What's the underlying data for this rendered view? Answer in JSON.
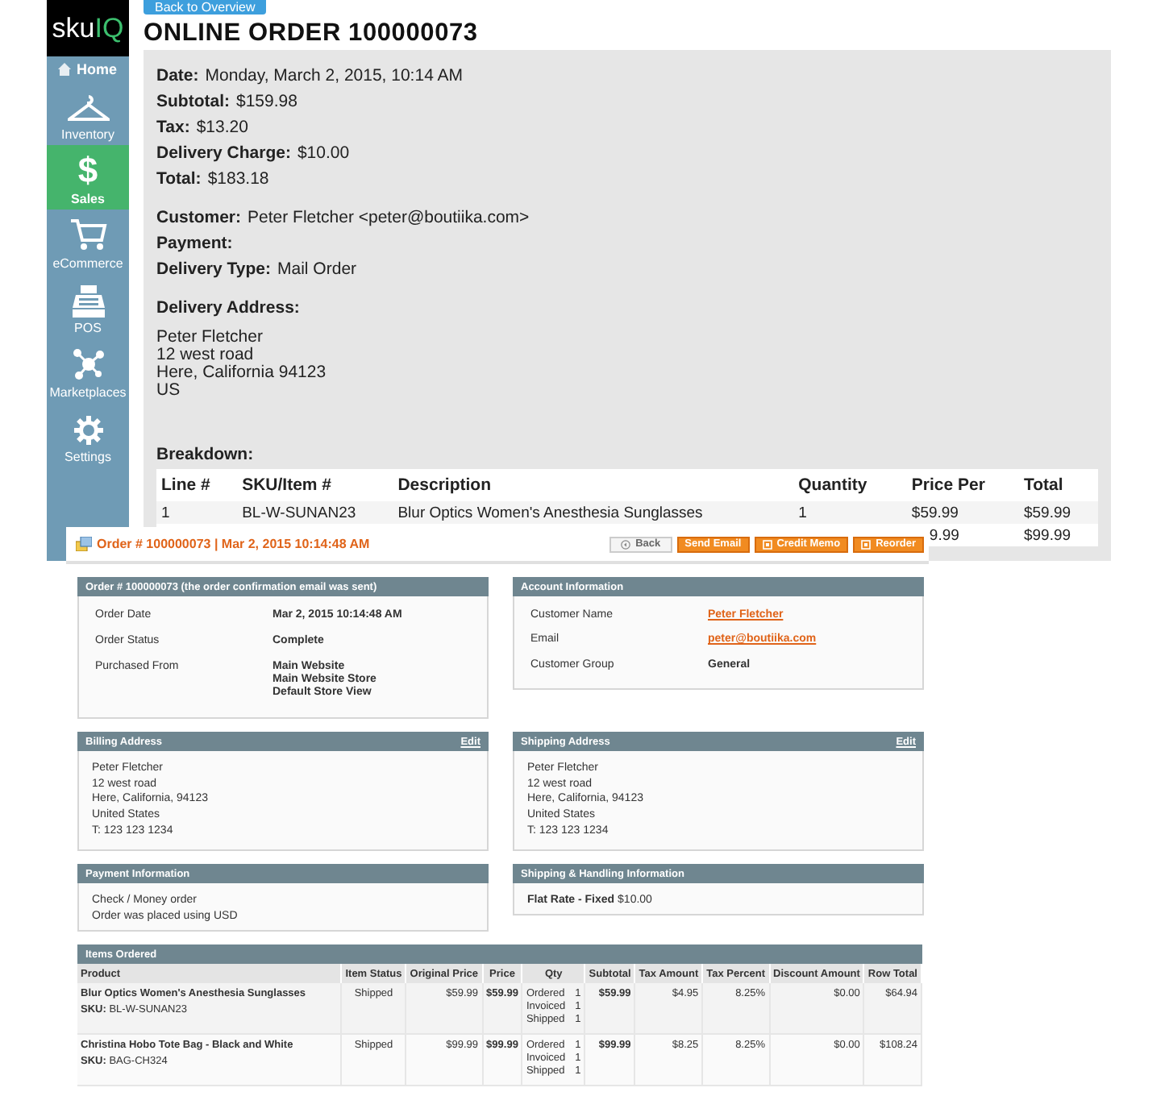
{
  "sidebar": {
    "logo": {
      "first": "sku",
      "second": "IQ"
    },
    "items": [
      {
        "kind": "home",
        "label": "Home",
        "selected": false
      },
      {
        "kind": "hanger",
        "label": "Inventory",
        "selected": false
      },
      {
        "kind": "dollar",
        "glyph": "$",
        "label": "Sales",
        "selected": true
      },
      {
        "kind": "cart",
        "label": "eCommerce",
        "selected": false
      },
      {
        "kind": "register",
        "label": "POS",
        "selected": false
      },
      {
        "kind": "network",
        "label": "Marketplaces",
        "selected": false
      },
      {
        "kind": "gear",
        "label": "Settings",
        "selected": false
      }
    ]
  },
  "back_button": "Back to Overview",
  "title": "ONLINE ORDER 100000073",
  "summary": [
    {
      "label": "Date:",
      "value": "Monday, March 2, 2015, 10:14 AM"
    },
    {
      "label": "Subtotal:",
      "value": "$159.98"
    },
    {
      "label": "Tax:",
      "value": "$13.20"
    },
    {
      "label": "Delivery Charge:",
      "value": "$10.00"
    },
    {
      "label": "Total:",
      "value": "$183.18"
    }
  ],
  "customer": [
    {
      "label": "Customer:",
      "value": "Peter Fletcher <peter@boutiika.com>"
    },
    {
      "label": "Payment:"
    },
    {
      "label": "Delivery Type:",
      "value": "Mail Order"
    }
  ],
  "delivery_address": {
    "label": "Delivery Address:",
    "lines": [
      "Peter Fletcher",
      "12 west road",
      "Here, California 94123",
      "US"
    ]
  },
  "breakdown": {
    "label": "Breakdown:",
    "columns": [
      "Line #",
      "SKU/Item #",
      "Description",
      "Quantity",
      "Price Per",
      "Total"
    ],
    "rows": [
      {
        "line": "1",
        "sku": "BL-W-SUNAN23",
        "description": "Blur Optics Women's Anesthesia Sunglasses",
        "quantity": "1",
        "price_per": "$59.99",
        "total": "$59.99"
      },
      {
        "price_per": "9.99",
        "total": "$99.99"
      }
    ]
  },
  "order_view": {
    "title": "Order # 100000073 | Mar 2, 2015 10:14:48 AM",
    "buttons": [
      {
        "kind": "back",
        "label": "Back"
      },
      {
        "kind": "plain",
        "label": "Send Email"
      },
      {
        "kind": "document",
        "label": "Credit Memo"
      },
      {
        "kind": "document",
        "label": "Reorder"
      }
    ],
    "order_box": {
      "title": "Order # 100000073 (the order confirmation email was sent)",
      "fields": [
        {
          "label": "Order Date",
          "values": [
            "Mar 2, 2015 10:14:48 AM"
          ],
          "link": false
        },
        {
          "label": "Order Status",
          "values": [
            "Complete"
          ],
          "link": false
        },
        {
          "label": "Purchased From",
          "values": [
            "Main Website",
            "Main Website Store",
            "Default Store View"
          ],
          "link": false
        }
      ]
    },
    "account_box": {
      "title": "Account Information",
      "fields": [
        {
          "label": "Customer Name",
          "values": [
            "Peter Fletcher"
          ],
          "link": true
        },
        {
          "label": "Email",
          "values": [
            "peter@boutiika.com"
          ],
          "link": true
        },
        {
          "label": "Customer Group",
          "values": [
            "General"
          ],
          "link": false
        }
      ]
    },
    "billing_address": {
      "title": "Billing Address",
      "action": "Edit",
      "lines": [
        "Peter Fletcher",
        "12 west road",
        "Here, California, 94123",
        "United States",
        "T: 123 123 1234"
      ]
    },
    "shipping_address": {
      "title": "Shipping Address",
      "action": "Edit",
      "lines": [
        "Peter Fletcher",
        "12 west road",
        "Here, California, 94123",
        "United States",
        "T: 123 123 1234"
      ]
    },
    "payment": {
      "title": "Payment Information",
      "lines": [
        "Check / Money order",
        "Order was placed using USD"
      ]
    },
    "shipping_handling": {
      "title": "Shipping & Handling Information",
      "method": "Flat Rate - Fixed",
      "price": "$10.00"
    },
    "items_ordered": {
      "title": "Items Ordered",
      "columns": [
        "Product",
        "Item Status",
        "Original Price",
        "Price",
        "Qty",
        "Subtotal",
        "Tax Amount",
        "Tax Percent",
        "Discount Amount",
        "Row Total"
      ],
      "rows": [
        {
          "product": "Blur Optics Women's Anesthesia Sunglasses",
          "sku_label": "SKU:",
          "sku": "BL-W-SUNAN23",
          "status": "Shipped",
          "original_price": "$59.99",
          "price": "$59.99",
          "qty": [
            {
              "label": "Ordered",
              "value": "1"
            },
            {
              "label": "Invoiced",
              "value": "1"
            },
            {
              "label": "Shipped",
              "value": "1"
            }
          ],
          "subtotal": "$59.99",
          "tax_amount": "$4.95",
          "tax_percent": "8.25%",
          "discount": "$0.00",
          "row_total": "$64.94"
        },
        {
          "product": "Christina Hobo Tote Bag - Black and White",
          "sku_label": "SKU:",
          "sku": "BAG-CH324",
          "status": "Shipped",
          "original_price": "$99.99",
          "price": "$99.99",
          "qty": [
            {
              "label": "Ordered",
              "value": "1"
            },
            {
              "label": "Invoiced",
              "value": "1"
            },
            {
              "label": "Shipped",
              "value": "1"
            }
          ],
          "subtotal": "$99.99",
          "tax_amount": "$8.25",
          "tax_percent": "8.25%",
          "discount": "$0.00",
          "row_total": "$108.24"
        }
      ]
    }
  }
}
